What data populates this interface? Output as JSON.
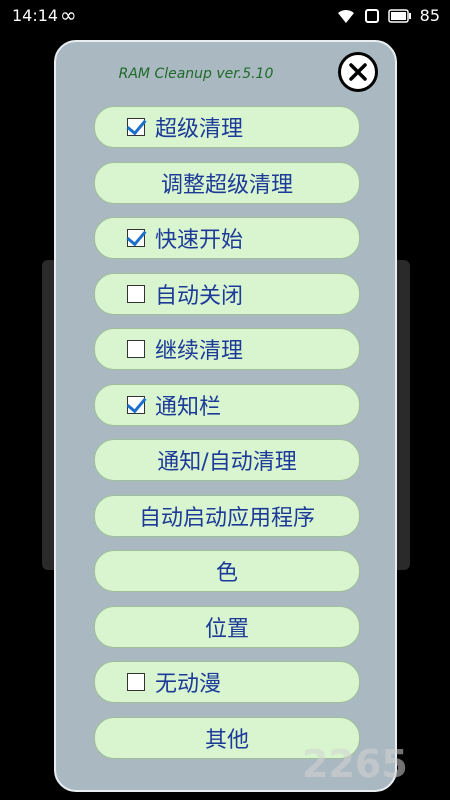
{
  "status_bar": {
    "time": "14:14",
    "loop_symbol": "∞",
    "battery_level": "85"
  },
  "dialog": {
    "title": "RAM Cleanup ver.5.10"
  },
  "menu": [
    {
      "label": "超级清理",
      "checkable": true,
      "checked": true
    },
    {
      "label": "调整超级清理",
      "checkable": false
    },
    {
      "label": "快速开始",
      "checkable": true,
      "checked": true
    },
    {
      "label": "自动关闭",
      "checkable": true,
      "checked": false
    },
    {
      "label": "继续清理",
      "checkable": true,
      "checked": false
    },
    {
      "label": "通知栏",
      "checkable": true,
      "checked": true
    },
    {
      "label": "通知/自动清理",
      "checkable": false
    },
    {
      "label": "自动启动应用程序",
      "checkable": false
    },
    {
      "label": "色",
      "checkable": false
    },
    {
      "label": "位置",
      "checkable": false
    },
    {
      "label": "无动漫",
      "checkable": true,
      "checked": false
    },
    {
      "label": "其他",
      "checkable": false
    }
  ],
  "watermark": "2265",
  "colors": {
    "button_bg": "#d8f5cf",
    "text": "#1e3a99",
    "dialog_bg": "#aab9c1",
    "check": "#1c70c9"
  }
}
